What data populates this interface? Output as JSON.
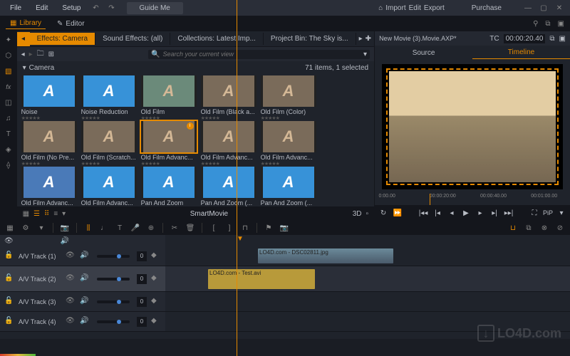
{
  "menu": {
    "file": "File",
    "edit": "Edit",
    "setup": "Setup",
    "guide": "Guide Me"
  },
  "actions": {
    "import": "Import",
    "edit": "Edit",
    "export": "Export",
    "purchase": "Purchase"
  },
  "panels": {
    "library": "Library",
    "editor": "Editor"
  },
  "tabs": [
    "Effects: Camera",
    "Sound Effects: (all)",
    "Collections: Latest Imp...",
    "Project Bin: The Sky is..."
  ],
  "search": {
    "placeholder": "Search your current view"
  },
  "crumb": "Camera",
  "item_count": "71 items, 1 selected",
  "thumbs_row1": [
    {
      "label": "Noise",
      "variant": ""
    },
    {
      "label": "Noise Reduction",
      "variant": ""
    },
    {
      "label": "Old Film",
      "variant": "teal"
    },
    {
      "label": "Old Film (Black a...",
      "variant": "brown"
    },
    {
      "label": "Old Film (Color)",
      "variant": "brown"
    }
  ],
  "thumbs_row2": [
    {
      "label": "Old Film (No Pre...",
      "variant": "brown"
    },
    {
      "label": "Old Film (Scratch...",
      "variant": "brown"
    },
    {
      "label": "Old Film Advanc...",
      "variant": "brown",
      "selected": true
    },
    {
      "label": "Old Film Advanc...",
      "variant": "brown"
    },
    {
      "label": "Old Film Advanc...",
      "variant": "brown"
    }
  ],
  "thumbs_row3": [
    {
      "label": "Old Film Advanc...",
      "variant": "blue2"
    },
    {
      "label": "Old Film Advanc...",
      "variant": ""
    },
    {
      "label": "Pan And Zoom",
      "variant": ""
    },
    {
      "label": "Pan And Zoom (...",
      "variant": ""
    },
    {
      "label": "Pan And Zoom (...",
      "variant": ""
    }
  ],
  "smartmovie": "SmartMovie",
  "view_3d": "3D",
  "preview": {
    "title": "New Movie (3).Movie.AXP*",
    "tc_label": "TC",
    "timecode": "00:00:20.40",
    "tabs": {
      "source": "Source",
      "timeline": "Timeline"
    },
    "ruler": [
      "0:00.00",
      "00:00:20:00",
      "00:00:40.00",
      "00:01:00.00"
    ],
    "pip": "PiP"
  },
  "tracks": [
    {
      "name": "A/V Track (1)",
      "level": "0"
    },
    {
      "name": "A/V Track (2)",
      "level": "0"
    },
    {
      "name": "A/V Track (3)",
      "level": "0"
    },
    {
      "name": "A/V Track (4)",
      "level": "0"
    }
  ],
  "clips": {
    "video1": "LO4D.com - DSC02811.jpg",
    "audio2": "LO4D.com - Test.avi"
  },
  "watermark": "LO4D.com",
  "colors": {
    "accent": "#e68a00",
    "blue": "#1e6fd4"
  }
}
